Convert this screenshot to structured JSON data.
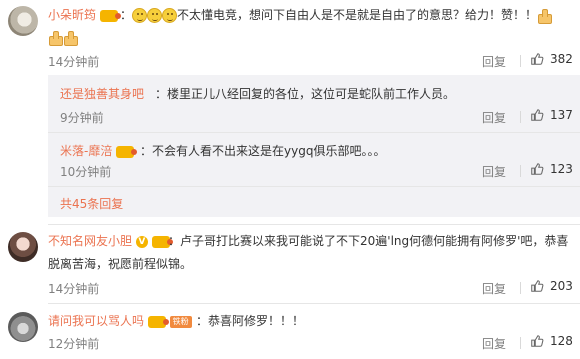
{
  "comments": [
    {
      "user": "小朵昕筠",
      "text_a": "不太懂电竞，想问下自由人是不是就是自由了的意思？给力！赞！！",
      "time": "14分钟前",
      "reply_label": "回复",
      "likes": "382"
    },
    {
      "user": "不知名网友小胆",
      "text_line1": "：卢子哥打比赛以来我可能说了不下20遍'lng何德何能拥有阿修罗'吧，恭喜",
      "text_line2": "脱离苦海，祝愿前程似锦。",
      "time": "14分钟前",
      "reply_label": "回复",
      "likes": "203"
    },
    {
      "user": "请问我可以骂人吗",
      "badge": "铁粉",
      "text": "：恭喜阿修罗！！！",
      "time": "12分钟前",
      "reply_label": "回复",
      "likes": "128"
    }
  ],
  "replies": [
    {
      "user": "还是独善其身吧",
      "text": "：楼里正儿八经回复的各位，这位可是蛇队前工作人员。",
      "time": "9分钟前",
      "reply_label": "回复",
      "likes": "137"
    },
    {
      "user": "米落-靡涪",
      "text": "：不会有人看不出来这是在yygq俱乐部吧。。。",
      "time": "10分钟前",
      "reply_label": "回复",
      "likes": "123"
    }
  ],
  "more_replies": "共45条回复",
  "vip_label": "V"
}
